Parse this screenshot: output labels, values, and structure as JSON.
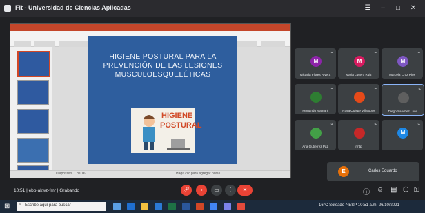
{
  "window": {
    "title": "Fit - Universidad de Ciencias Aplicadas"
  },
  "presentation": {
    "slide_title": "HIGIENE POSTURAL PARA LA PREVENCIÓN DE LAS LESIONES MUSCULOESQUELÉTICAS",
    "illustration_text": [
      "HIGIENE",
      "POSTURAL"
    ],
    "status_text": "Diapositiva 1 de 16",
    "notes_text": "Haga clic para agregar notas"
  },
  "participants": [
    {
      "initial": "M",
      "name": "Micaela Flores Rivera",
      "color": "#8e24aa",
      "icon": "person-icon"
    },
    {
      "initial": "M",
      "name": "Maria Lucero Ruiz",
      "color": "#d81b60",
      "icon": "person-icon"
    },
    {
      "initial": "M",
      "name": "Marcela Cruz Rios",
      "color": "#7e57c2",
      "icon": "person-icon"
    },
    {
      "initial": "",
      "name": "Fernando Mamani",
      "color": "#2e7d32",
      "icon": "face-icon"
    },
    {
      "initial": "",
      "name": "Rosa Quispe Villalobos",
      "color": "#e64a19",
      "icon": "dot-icon"
    },
    {
      "initial": "",
      "name": "Diego Sanchez Luna",
      "color": "#5f5f5f",
      "icon": "camera-icon"
    },
    {
      "initial": "",
      "name": "Ana Gutierrez Paz",
      "color": "#43a047",
      "icon": "face-icon"
    },
    {
      "initial": "",
      "name": "rmtp",
      "color": "#c62828",
      "icon": "dots-icon"
    },
    {
      "initial": "M",
      "name": "",
      "color": "#1e88e5",
      "icon": "person-icon"
    }
  ],
  "self_tile": {
    "initial": "E",
    "name": "Carlos Eduardo"
  },
  "meeting": {
    "info": "10:51 | ebp-akwz-fmr | Grabando"
  },
  "controls": {
    "end_call": "✕"
  },
  "taskbar": {
    "search_placeholder": "Escribe aquí para buscar",
    "tray_text": "16°C Soleado  ^ ESP 10:51 a.m. 26/10/2021"
  }
}
